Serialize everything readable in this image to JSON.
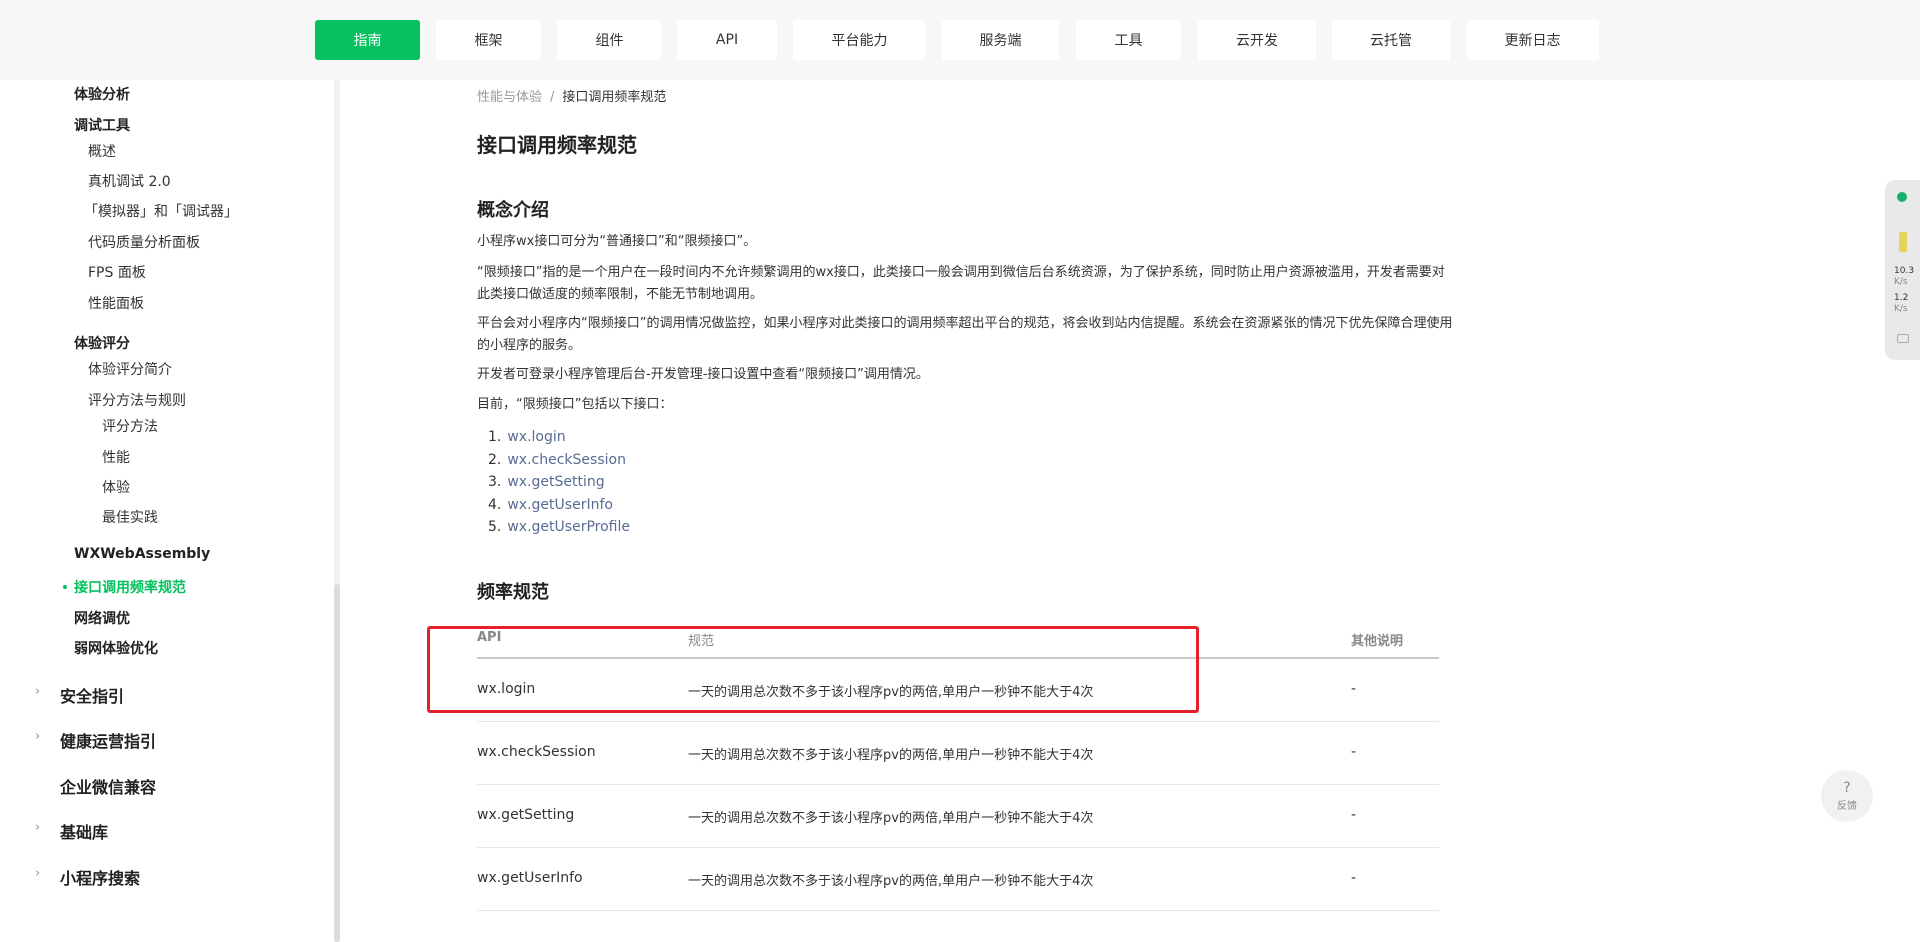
{
  "nav": {
    "items": [
      "指南",
      "框架",
      "组件",
      "API",
      "平台能力",
      "服务端",
      "工具",
      "云开发",
      "云托管",
      "更新日志"
    ],
    "active": "指南"
  },
  "sidebar": {
    "items": [
      {
        "label": "体验分析"
      },
      {
        "label": "调试工具"
      },
      {
        "label": "概述"
      },
      {
        "label": "真机调试 2.0"
      },
      {
        "label": "「模拟器」和「调试器」"
      },
      {
        "label": "代码质量分析面板"
      },
      {
        "label": "FPS 面板"
      },
      {
        "label": "性能面板"
      },
      {
        "label": "体验评分"
      },
      {
        "label": "体验评分简介"
      },
      {
        "label": "评分方法与规则"
      },
      {
        "label": "评分方法"
      },
      {
        "label": "性能"
      },
      {
        "label": "体验"
      },
      {
        "label": "最佳实践"
      },
      {
        "label": "WXWebAssembly"
      },
      {
        "label": "接口调用频率规范"
      },
      {
        "label": "网络调优"
      },
      {
        "label": "弱网体验优化"
      },
      {
        "label": "安全指引"
      },
      {
        "label": "健康运营指引"
      },
      {
        "label": "企业微信兼容"
      },
      {
        "label": "基础库"
      },
      {
        "label": "小程序搜索"
      }
    ]
  },
  "breadcrumb": {
    "parent": "性能与体验",
    "separator": "/",
    "current": "接口调用频率规范"
  },
  "page": {
    "title": "接口调用频率规范",
    "section1_title": "概念介绍",
    "paragraphs": [
      "小程序wx接口可分为“普通接口”和“限频接口”。",
      "“限频接口”指的是一个用户在一段时间内不允许频繁调用的wx接口，此类接口一般会调用到微信后台系统资源，为了保护系统，同时防止用户资源被滥用，开发者需要对此类接口做适度的频率限制，不能无节制地调用。",
      "平台会对小程序内“限频接口”的调用情况做监控，如果小程序对此类接口的调用频率超出平台的规范，将会收到站内信提醒。系统会在资源紧张的情况下优先保障合理使用的小程序的服务。",
      "开发者可登录小程序管理后台-开发管理-接口设置中查看“限频接口”调用情况。",
      "目前，“限频接口”包括以下接口："
    ],
    "api_list": [
      "wx.login",
      "wx.checkSession",
      "wx.getSetting",
      "wx.getUserInfo",
      "wx.getUserProfile"
    ],
    "section2_title": "频率规范"
  },
  "table": {
    "headers": [
      "API",
      "规范",
      "其他说明"
    ],
    "rows": [
      [
        "wx.login",
        "一天的调用总次数不多于该小程序pv的两倍,单用户一秒钟不能大于4次",
        "-"
      ],
      [
        "wx.checkSession",
        "一天的调用总次数不多于该小程序pv的两倍,单用户一秒钟不能大于4次",
        "-"
      ],
      [
        "wx.getSetting",
        "一天的调用总次数不多于该小程序pv的两倍,单用户一秒钟不能大于4次",
        "-"
      ],
      [
        "wx.getUserInfo",
        "一天的调用总次数不多于该小程序pv的两倍,单用户一秒钟不能大于4次",
        "-"
      ]
    ]
  },
  "widget": {
    "line1": "10.3",
    "line2": "K/s",
    "line3": "1.2",
    "line4": "K/s"
  },
  "feedback": {
    "icon": "?",
    "label": "反馈"
  },
  "colors": {
    "accent": "#07c160",
    "link": "#576b95",
    "highlight": "#e5202a"
  }
}
